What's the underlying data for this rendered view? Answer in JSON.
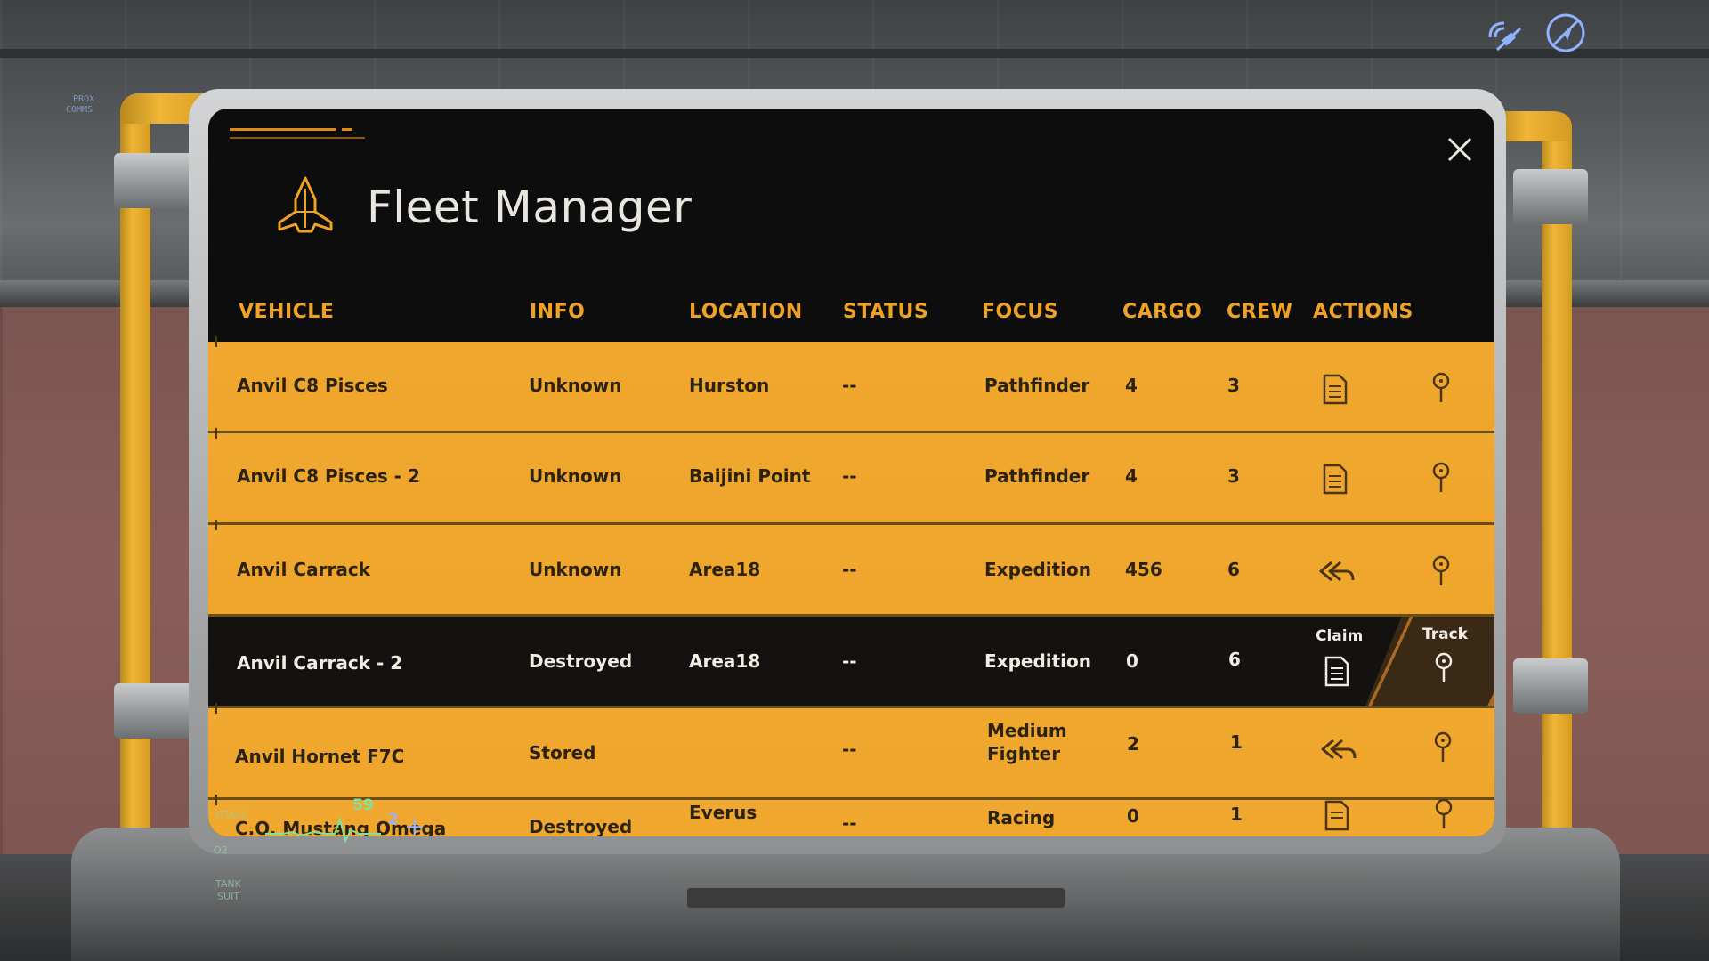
{
  "window": {
    "title": "Fleet Manager",
    "close_icon": "close-icon",
    "accent_color": "#f0a224"
  },
  "hud": {
    "left_labels": [
      "PROX",
      "COMMS"
    ],
    "signal_icon": "satellite-signal-icon",
    "nav_icon": "navigation-off-icon"
  },
  "columns": [
    "VEHICLE",
    "INFO",
    "LOCATION",
    "STATUS",
    "FOCUS",
    "CARGO",
    "CREW",
    "ACTIONS"
  ],
  "rows": [
    {
      "vehicle": "Anvil C8 Pisces",
      "info": "Unknown",
      "location": "Hurston",
      "status": "--",
      "focus": "Pathfinder",
      "cargo": "4",
      "crew": "3",
      "action": "claim-icon",
      "track": "pin-icon"
    },
    {
      "vehicle": "Anvil C8 Pisces - 2",
      "info": "Unknown",
      "location": "Baijini Point",
      "status": "--",
      "focus": "Pathfinder",
      "cargo": "4",
      "crew": "3",
      "action": "claim-icon",
      "track": "pin-icon"
    },
    {
      "vehicle": "Anvil Carrack",
      "info": "Unknown",
      "location": "Area18",
      "status": "--",
      "focus": "Expedition",
      "cargo": "456",
      "crew": "6",
      "action": "retrieve-icon",
      "track": "pin-icon"
    },
    {
      "vehicle": "Anvil Carrack - 2",
      "info": "Destroyed",
      "location": "Area18",
      "status": "--",
      "focus": "Expedition",
      "cargo": "0",
      "crew": "6",
      "action": "claim-icon",
      "track": "pin-icon",
      "claim_label": "Claim",
      "track_label": "Track",
      "selected": true
    },
    {
      "vehicle": "Anvil Hornet F7C",
      "info": "Stored",
      "location": "",
      "status": "--",
      "focus_line1": "Medium",
      "focus_line2": "Fighter",
      "cargo": "2",
      "crew": "1",
      "action": "retrieve-icon",
      "track": "pin-icon"
    },
    {
      "vehicle": "C.O. Mustang Omega",
      "info": "Destroyed",
      "location": "Everus",
      "status": "--",
      "focus": "Racing",
      "cargo": "0",
      "crew": "1",
      "action": "claim-icon",
      "track": "pin-icon"
    }
  ],
  "vitals": {
    "label": "VITALS",
    "heart_rate": "59",
    "o2_label": "O2",
    "oxygen": "2",
    "status_labels": [
      "TANK",
      "SUIT"
    ]
  }
}
